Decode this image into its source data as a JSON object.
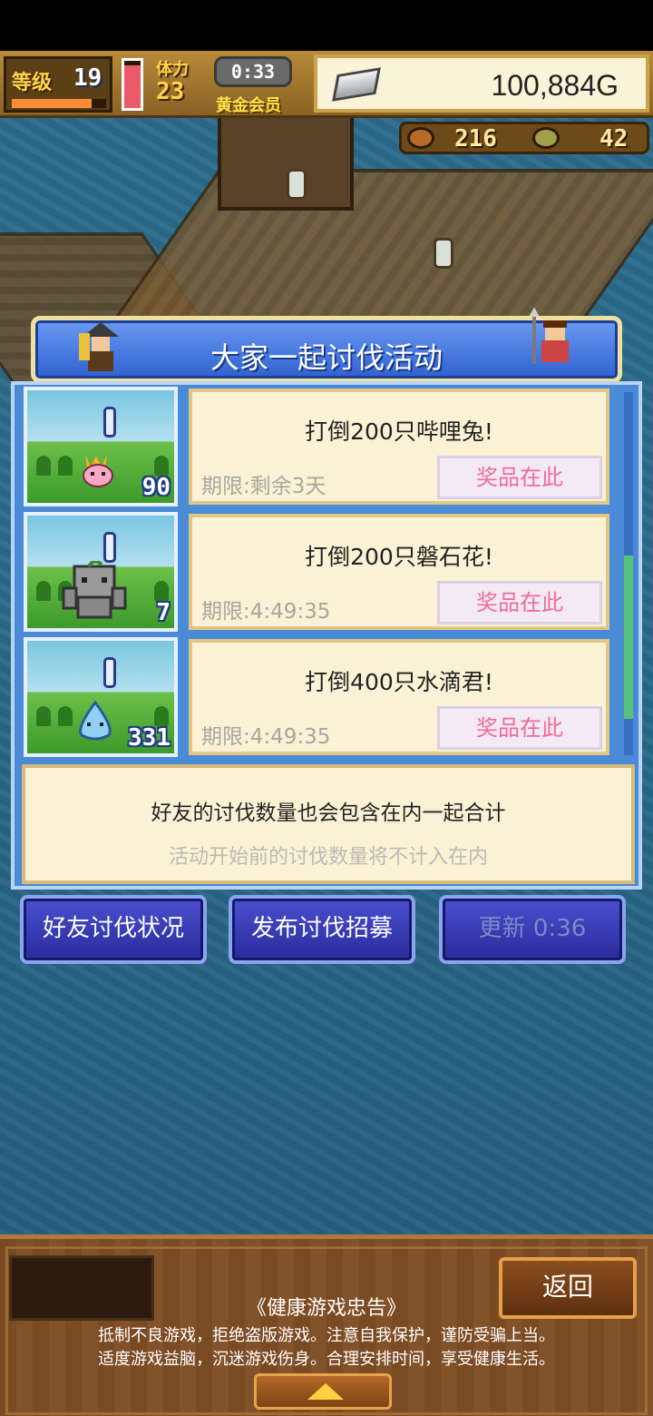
{
  "hud": {
    "level_label": "等级",
    "level": "19",
    "level_progress": 0.85,
    "hp_fraction": 0.9,
    "stamina_label": "体力",
    "stamina": "23",
    "timer": "0:33",
    "membership": "黄金会员",
    "gold": "100,884G",
    "resource_a": "216",
    "resource_b": "42"
  },
  "panel": {
    "title": "大家一起讨伐活动",
    "quests": [
      {
        "title": "打倒200只哔哩兔!",
        "deadline": "期限:剩余3天",
        "prize": "奖品在此",
        "count": "90",
        "monster_icon": "pink-rabbit-icon"
      },
      {
        "title": "打倒200只磐石花!",
        "deadline": "期限:4:49:35",
        "prize": "奖品在此",
        "count": "7",
        "monster_icon": "rock-golem-icon"
      },
      {
        "title": "打倒400只水滴君!",
        "deadline": "期限:4:49:35",
        "prize": "奖品在此",
        "count": "331",
        "monster_icon": "water-drop-icon"
      }
    ],
    "note_main": "好友的讨伐数量也会包含在内一起合计",
    "note_sub": "活动开始前的讨伐数量将不计入在内"
  },
  "buttons": {
    "friend_status": "好友讨伐状况",
    "publish_recruit": "发布讨伐招募",
    "refresh": "更新 0:36"
  },
  "bottom": {
    "back": "返回",
    "health_title": "《健康游戏忠告》",
    "health_line1": "抵制不良游戏，拒绝盗版游戏。注意自我保护，谨防受骗上当。",
    "health_line2": "适度游戏益脑，沉迷游戏伤身。合理安排时间，享受健康生活。"
  },
  "colors": {
    "panel_blue": "#4a8ad6",
    "prize_pink": "#f26a9a",
    "button_blue": "#2a2c9a"
  }
}
